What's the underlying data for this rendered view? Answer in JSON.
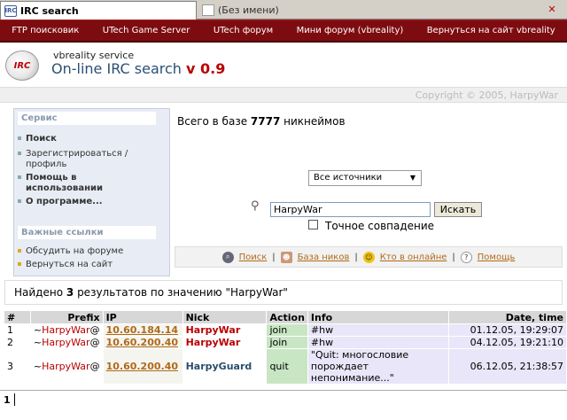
{
  "tabs": [
    {
      "label": "IRC search",
      "icon": "irc-tab-icon"
    },
    {
      "label": "(Без имени)",
      "icon": "blank-page-icon"
    }
  ],
  "nav": [
    "FTP поисковик",
    "UTech Game Server",
    "UTech форум",
    "Мини форум (vbreality)",
    "Вернуться на сайт vbreality"
  ],
  "header": {
    "logo_text": "IRC",
    "subtitle": "vbreality service",
    "title": "On-line IRC search",
    "version": "v 0.9",
    "copyright": "Copyright © 2005, HarpyWar"
  },
  "sidebar": {
    "service_title": "Сервис",
    "service_items": [
      "Поиск",
      "Зарегистрироваться /",
      "профиль",
      "Помощь в",
      "использовании",
      "О программе..."
    ],
    "links_title": "Важные ссылки",
    "links_items": [
      "Обсудить на форуме",
      "Вернуться на сайт"
    ]
  },
  "main": {
    "db_prefix": "Всего в базе",
    "db_count": "7777",
    "db_suffix": "никнеймов",
    "source_select": "Все источники",
    "search_value": "HarpyWar",
    "search_button": "Искать",
    "exact_label": "Точное совпадение",
    "links": [
      "Поиск",
      "База ников",
      "Кто в онлайне",
      "Помощь"
    ]
  },
  "found": {
    "prefix": "Найдено",
    "count": "3",
    "suffix": "результатов по значению \"HarpyWar\""
  },
  "table": {
    "headers": [
      "#",
      "Prefix",
      "IP",
      "Nick",
      "Action",
      "Info",
      "Date, time"
    ],
    "rows": [
      {
        "num": "1",
        "prefix_pre": "~",
        "prefix_nick": "HarpyWar",
        "prefix_at": "@",
        "ip": "10.60.184.14",
        "nick": "HarpyWar",
        "action": "join",
        "info": "#hw",
        "date": "01.12.05, 19:29:07"
      },
      {
        "num": "2",
        "prefix_pre": "~",
        "prefix_nick": "HarpyWar",
        "prefix_at": "@",
        "ip": "10.60.200.40",
        "nick": "HarpyWar",
        "action": "join",
        "info": "#hw",
        "date": "04.12.05, 19:21:10"
      },
      {
        "num": "3",
        "prefix_pre": "~",
        "prefix_nick": "HarpyWar",
        "prefix_at": "@",
        "ip": "10.60.200.40",
        "nick": "HarpyGuard",
        "action": "quit",
        "info": "\"Quit: многословие порождает непонимание...\"",
        "date": "06.12.05, 21:38:57"
      }
    ]
  },
  "pager": {
    "page": "1"
  },
  "colors": {
    "nav_bg": "#7d0c10",
    "accent": "#b00000",
    "link": "#b06a1a",
    "title": "#2a4f75"
  }
}
